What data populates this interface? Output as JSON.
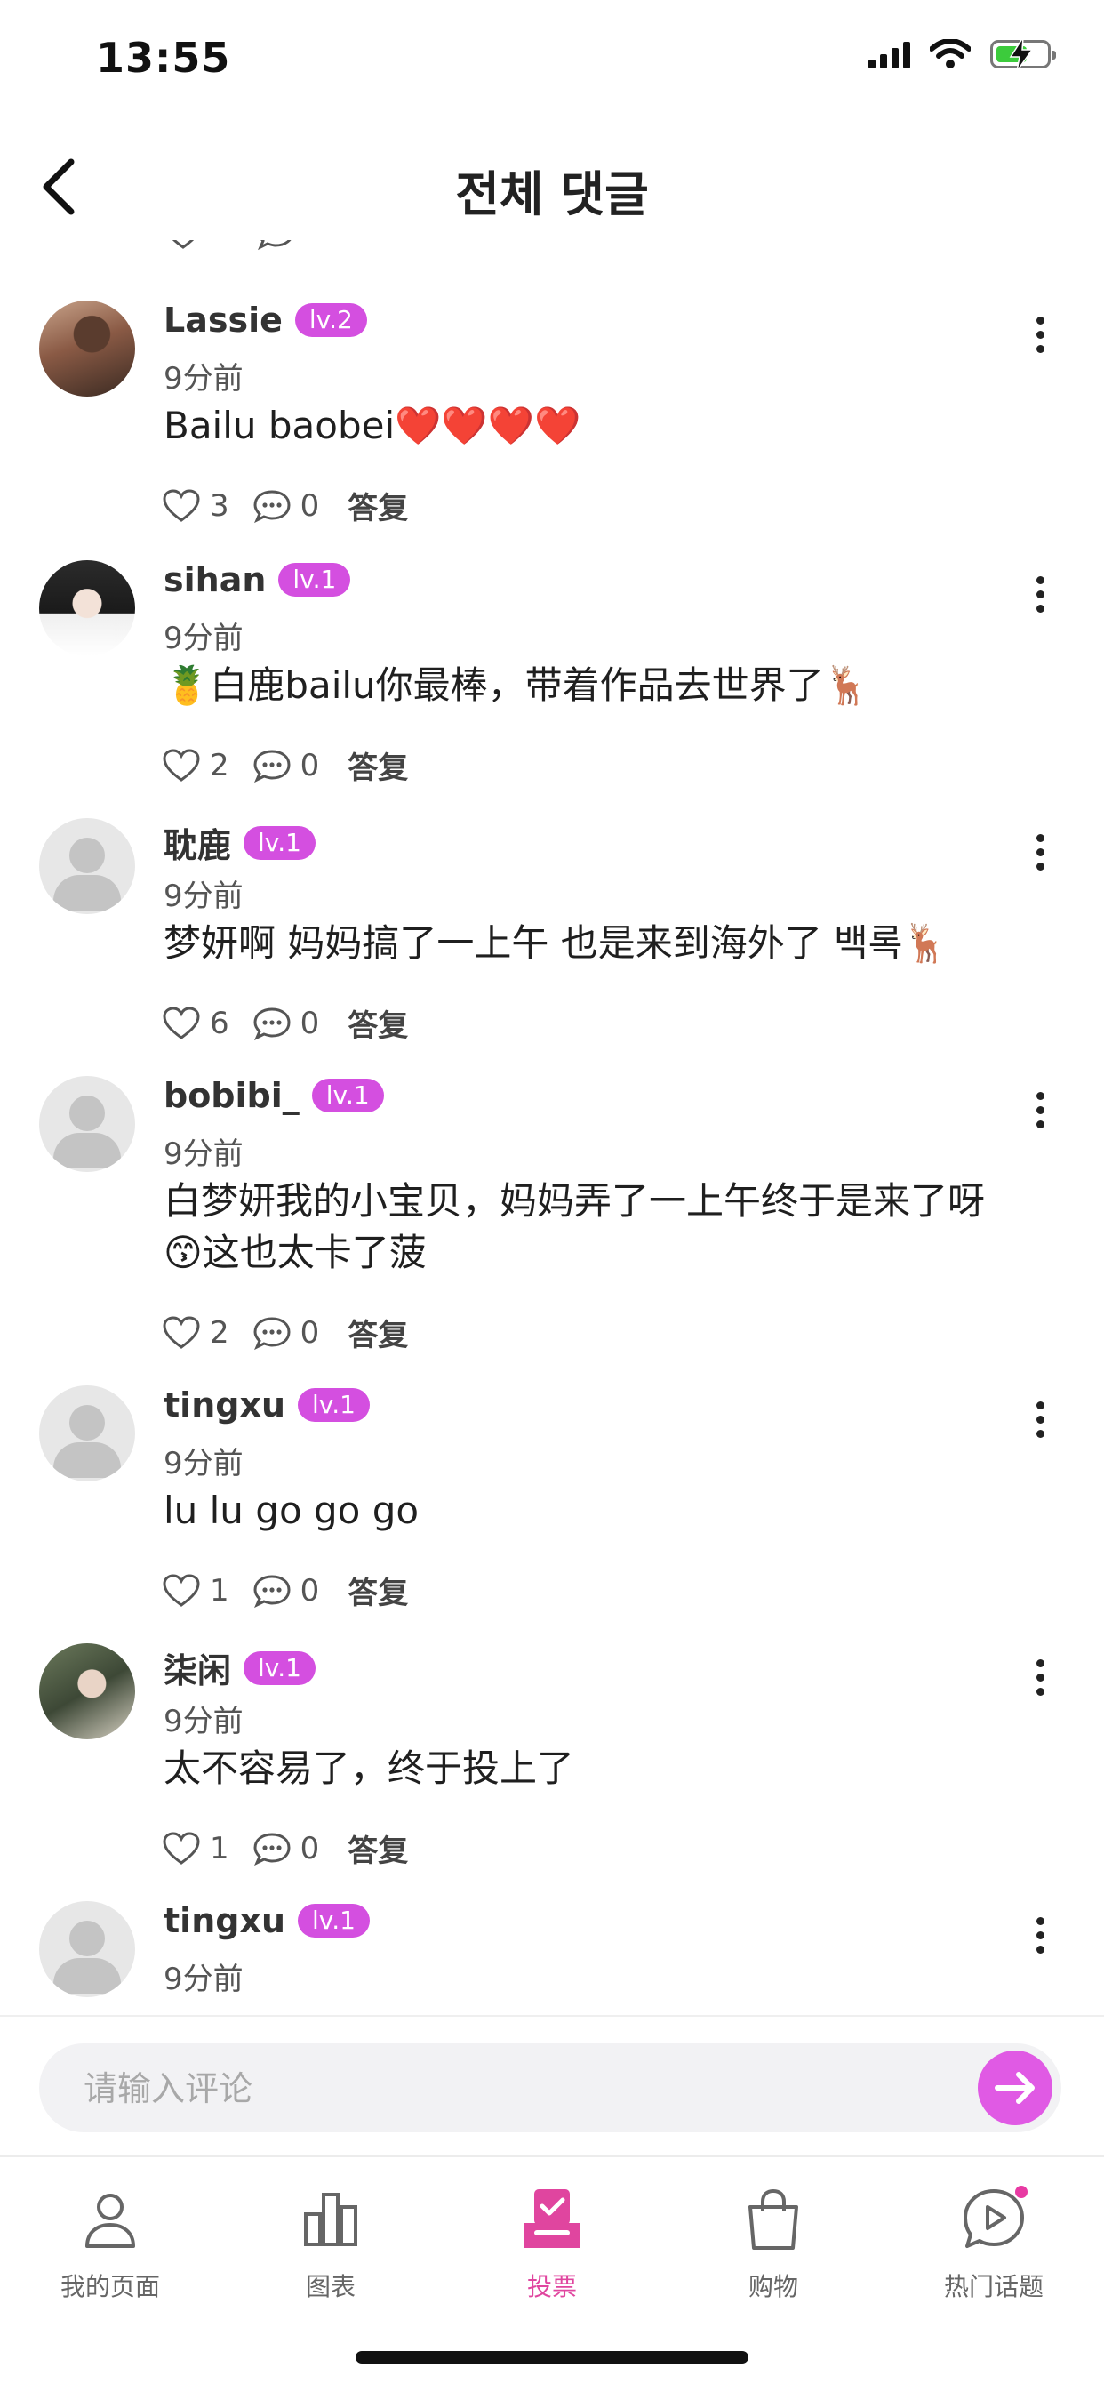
{
  "status_bar": {
    "time": "13:55"
  },
  "header": {
    "title": "전체 댓글"
  },
  "comments": [
    {
      "username": "Lassie",
      "level": "lv.2",
      "time": "9分前",
      "text": "Bailu baobei❤️❤️❤️❤️",
      "likes": "3",
      "replies": "0"
    },
    {
      "username": "sihan",
      "level": "lv.1",
      "time": "9分前",
      "text": "🍍白鹿bailu你最棒，带着作品去世界了🦌",
      "likes": "2",
      "replies": "0"
    },
    {
      "username": "耽鹿",
      "level": "lv.1",
      "time": "9分前",
      "text": "梦妍啊 妈妈搞了一上午 也是来到海外了 백록🦌",
      "likes": "6",
      "replies": "0"
    },
    {
      "username": "bobibi_",
      "level": "lv.1",
      "time": "9分前",
      "text": "白梦妍我的小宝贝，妈妈弄了一上午终于是来了呀😙这也太卡了菠",
      "likes": "2",
      "replies": "0"
    },
    {
      "username": "tingxu",
      "level": "lv.1",
      "time": "9分前",
      "text": "lu lu go go go",
      "likes": "1",
      "replies": "0"
    },
    {
      "username": "柒闲",
      "level": "lv.1",
      "time": "9分前",
      "text": "太不容易了，终于投上了",
      "likes": "1",
      "replies": "0"
    },
    {
      "username": "tingxu",
      "level": "lv.1",
      "time": "9分前"
    }
  ],
  "reply_label": "答复",
  "input": {
    "placeholder": "请输入评论"
  },
  "tabs": [
    {
      "label": "我的页面",
      "icon": "person-icon"
    },
    {
      "label": "图表",
      "icon": "bar-chart-icon"
    },
    {
      "label": "投票",
      "icon": "vote-box-icon",
      "active": true
    },
    {
      "label": "购物",
      "icon": "shopping-bag-icon"
    },
    {
      "label": "热门话题",
      "icon": "play-bubble-icon"
    }
  ],
  "colors": {
    "accent": "#d44fe0",
    "tab_active": "#e0459f",
    "badge_text": "#ffffff"
  }
}
